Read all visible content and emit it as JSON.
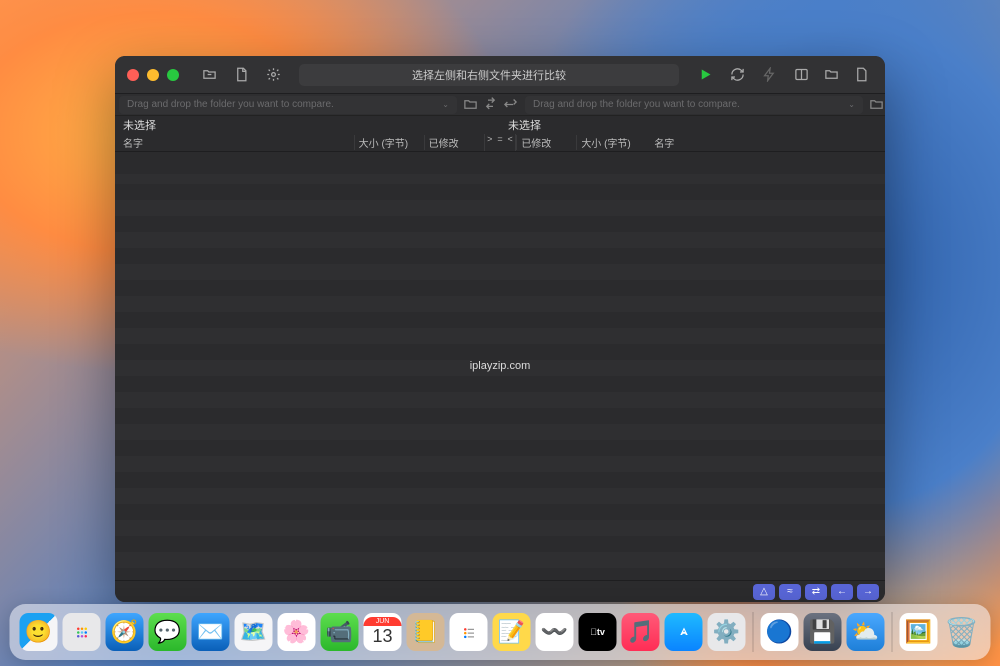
{
  "titlebar": {
    "title_hint": "选择左侧和右侧文件夹进行比较"
  },
  "subbar": {
    "drop_placeholder": "Drag and drop the folder you want to compare."
  },
  "status": {
    "left": "未选择",
    "right": "未选择"
  },
  "headers": {
    "name": "名字",
    "size": "大小 (字节)",
    "modified": "已修改",
    "cmp_gt": ">",
    "cmp_eq": "=",
    "cmp_lt": "<"
  },
  "watermark": "iplayzip.com",
  "footer_buttons": [
    "△",
    "≈",
    "⇄",
    "←",
    "→"
  ],
  "calendar": {
    "month": "JUN",
    "day": "13"
  }
}
